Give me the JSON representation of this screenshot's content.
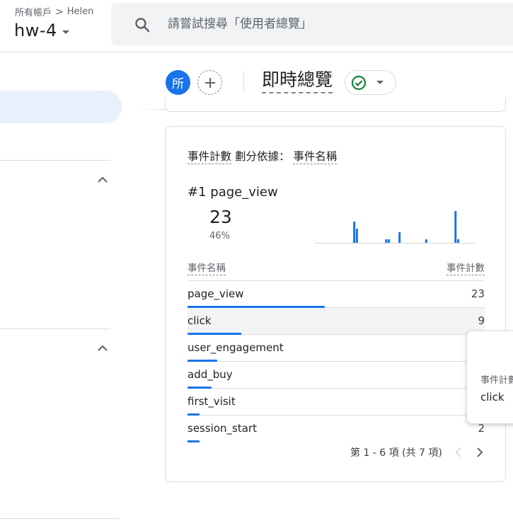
{
  "header": {
    "breadcrumb_root": "所有帳戶",
    "breadcrumb_account": "Helen",
    "property_name": "hw-4",
    "search_placeholder": "請嘗試搜尋「使用者總覽」"
  },
  "toolbar": {
    "avatar_letter": "所",
    "page_title": "即時總覽"
  },
  "card": {
    "title_metric": "事件計數",
    "title_by": "劃分依據：",
    "title_dimension": "事件名稱",
    "top_rank": "#1",
    "top_name": "page_view",
    "top_value": "23",
    "top_percent": "46%",
    "sparkline_values": [
      0,
      0,
      0,
      0,
      0,
      0,
      0,
      0,
      0,
      0,
      0,
      0,
      0,
      0,
      6,
      4,
      0,
      0,
      0,
      0,
      0,
      0,
      0,
      0,
      0,
      0,
      1,
      1,
      0,
      0,
      0,
      3,
      0,
      0,
      0,
      0,
      0,
      0,
      0,
      0,
      0,
      1,
      0,
      0,
      0,
      0,
      0,
      0,
      0,
      0,
      0,
      0,
      9,
      1,
      0,
      0,
      0,
      0,
      0,
      0
    ]
  },
  "table": {
    "col_name": "事件名稱",
    "col_count": "事件計數",
    "max": 23,
    "rows": [
      {
        "name": "page_view",
        "count": "23",
        "value": 23
      },
      {
        "name": "click",
        "count": "9",
        "value": 9
      },
      {
        "name": "user_engagement",
        "count": "",
        "value": 5
      },
      {
        "name": "add_buy",
        "count": "",
        "value": 4
      },
      {
        "name": "first_visit",
        "count": "",
        "value": 2
      },
      {
        "name": "session_start",
        "count": "2",
        "value": 2
      }
    ]
  },
  "pager": {
    "label": "第 1 - 6 項 (共 7 項)"
  },
  "tooltip": {
    "label": "事件計數",
    "value": "click"
  },
  "colors": {
    "accent": "#1a73e8",
    "success": "#188038"
  }
}
